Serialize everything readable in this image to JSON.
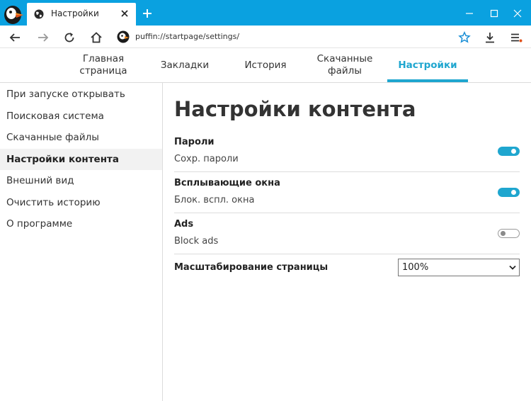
{
  "browser": {
    "tab_title": "Настройки",
    "url": "puffin://startpage/settings/"
  },
  "topnav": {
    "items": [
      {
        "label": "Главная\nстраница"
      },
      {
        "label": "Закладки"
      },
      {
        "label": "История"
      },
      {
        "label": "Скачанные\nфайлы"
      },
      {
        "label": "Настройки"
      }
    ],
    "active_index": 4
  },
  "sidebar": {
    "items": [
      {
        "label": "При запуске открывать"
      },
      {
        "label": "Поисковая система"
      },
      {
        "label": "Скачанные файлы"
      },
      {
        "label": "Настройки контента"
      },
      {
        "label": "Внешний вид"
      },
      {
        "label": "Очистить историю"
      },
      {
        "label": "О программе"
      }
    ],
    "active_index": 3
  },
  "content": {
    "title": "Настройки контента",
    "settings": [
      {
        "title": "Пароли",
        "description": "Сохр. пароли",
        "enabled": true
      },
      {
        "title": "Всплывающие окна",
        "description": "Блок. вспл. окна",
        "enabled": true
      },
      {
        "title": "Ads",
        "description": "Block ads",
        "enabled": false
      }
    ],
    "zoom": {
      "label": "Масштабирование страницы",
      "value": "100%"
    }
  },
  "colors": {
    "titlebar": "#0aa1e0",
    "accent": "#1fa6cf"
  }
}
